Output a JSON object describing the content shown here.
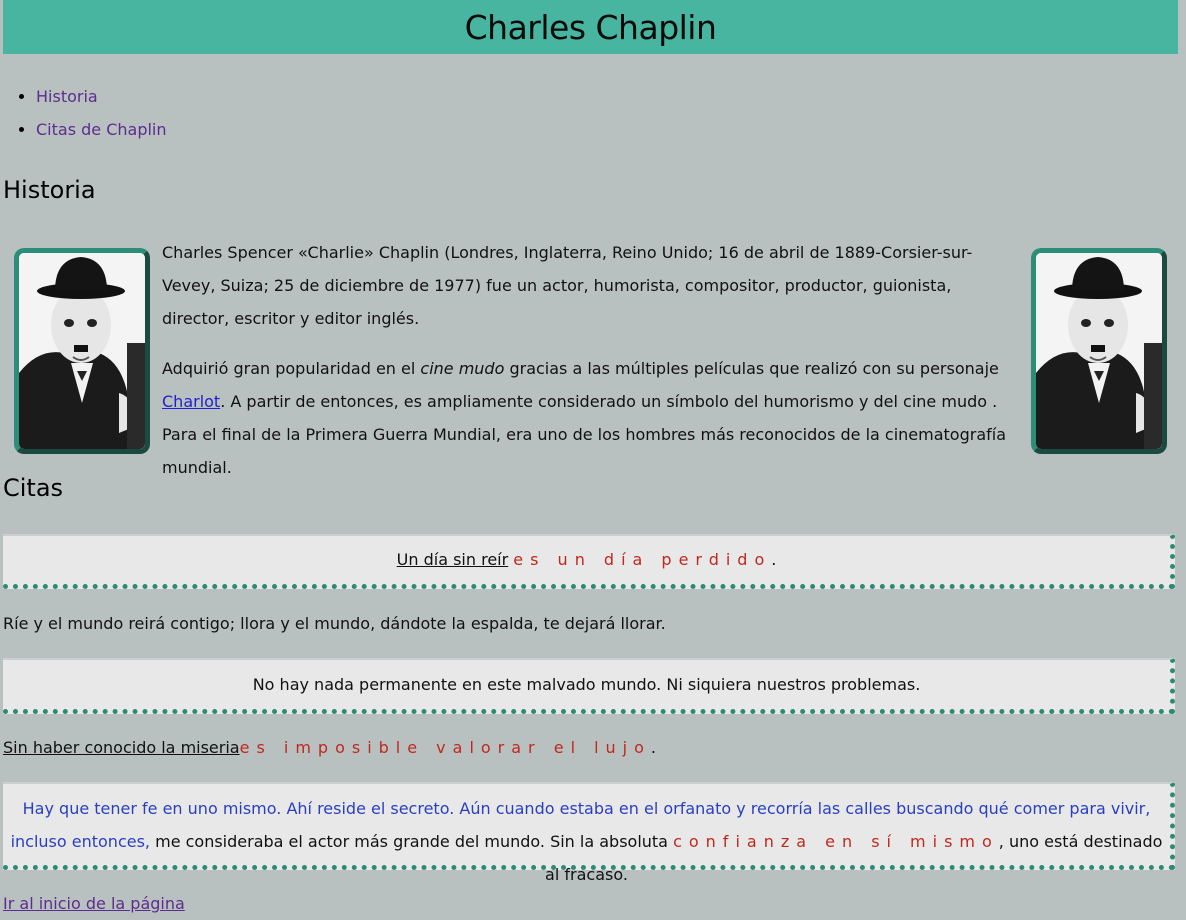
{
  "header": {
    "title": "Charles Chaplin"
  },
  "nav": {
    "items": [
      {
        "label": "Historia"
      },
      {
        "label": "Citas de Chaplin"
      }
    ]
  },
  "historia": {
    "heading": "Historia",
    "p1": "Charles Spencer «Charlie» Chaplin (Londres, Inglaterra, Reino Unido; 16 de abril de 1889-Corsier-sur-Vevey, Suiza; 25 de diciembre de 1977) fue un actor, humorista, compositor, productor, guionista, director, escritor y editor inglés.",
    "p2_a": "Adquirió gran popularidad en el ",
    "p2_em": "cine mudo",
    "p2_b": " gracias a las múltiples películas que realizó con su personaje ",
    "p2_link": "Charlot",
    "p2_c": ". A partir de entonces, es ampliamente considerado un símbolo del humorismo y del cine mudo . Para el final de la Primera Guerra Mundial, era uno de los hombres más reconocidos de la cinematografía mundial."
  },
  "citas": {
    "heading": "Citas",
    "q1_u": "Un día sin reír",
    "q1_red": "es un día perdido",
    "q1_end": ".",
    "q2": "Ríe y el mundo reirá contigo; llora y el mundo, dándote la espalda, te dejará llorar.",
    "q3": "No hay nada permanente en este malvado mundo. Ni siquiera nuestros problemas.",
    "q4_u": "Sin haber conocido la miseria",
    "q4_red": "es imposible valorar el lujo",
    "q4_end": ".",
    "q5_blue": "Hay que tener fe en uno mismo. Ahí reside el secreto. Aún cuando estaba en el orfanato y recorría las calles buscando qué comer para vivir, incluso entonces,",
    "q5_a": " me consideraba el actor más grande del mundo. Sin la absoluta ",
    "q5_red": "confianza en sí mismo",
    "q5_b": ", uno está destinado al fracaso."
  },
  "footer": {
    "top_link": "Ir al inicio de la página"
  }
}
